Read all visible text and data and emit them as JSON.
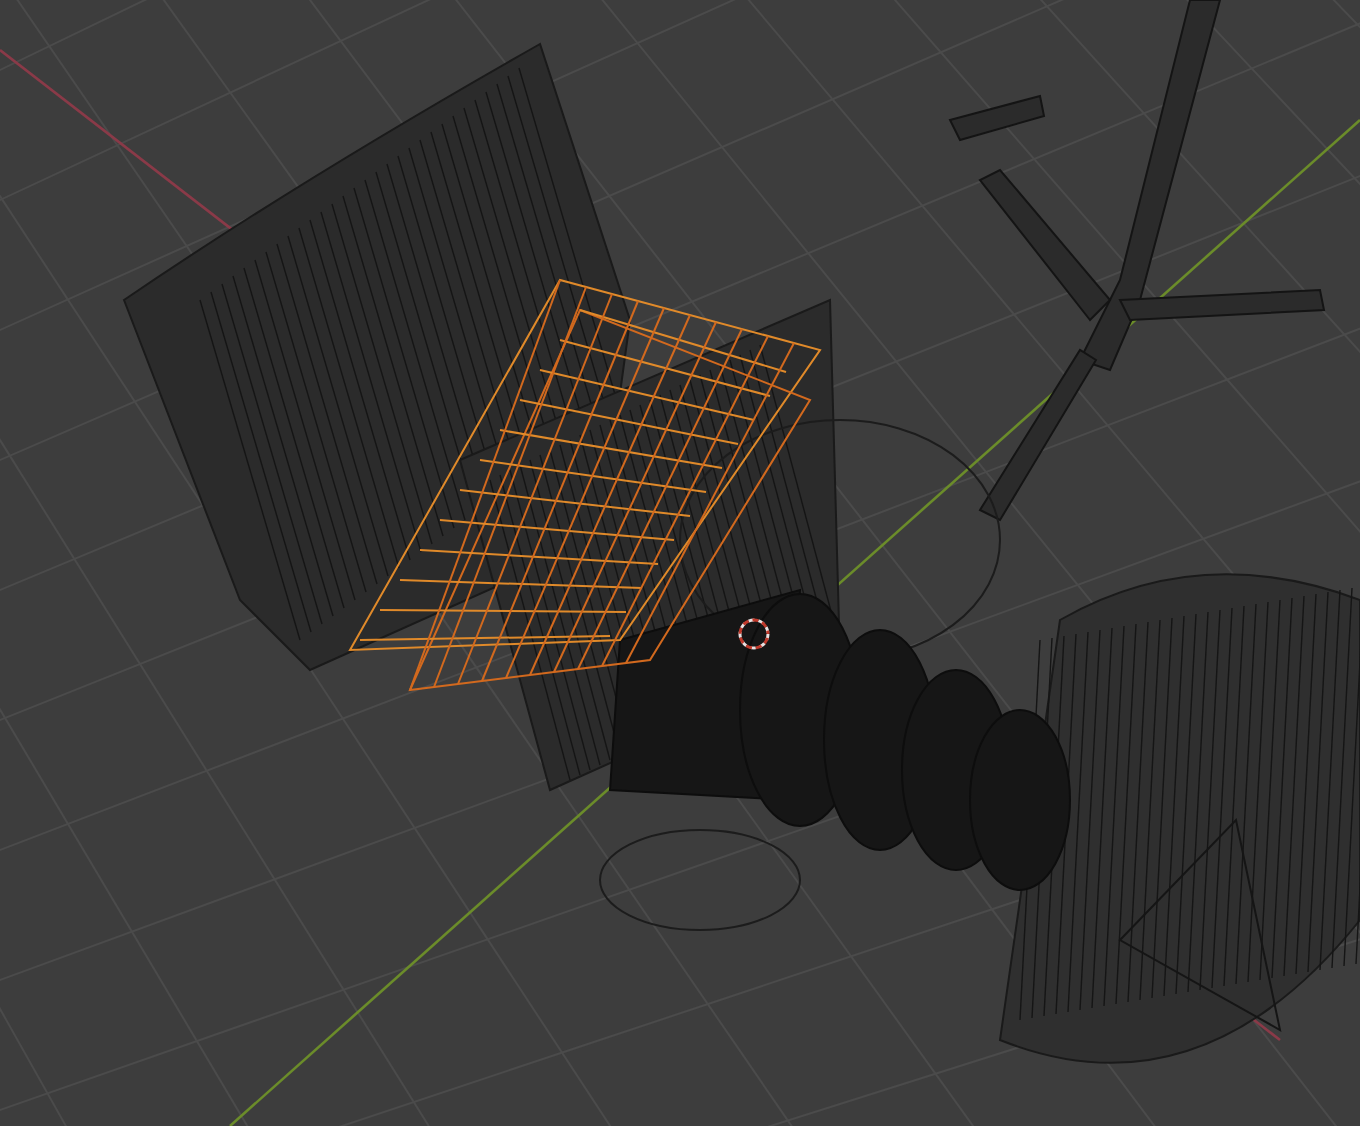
{
  "objects": [
    {
      "kind": "curved-panel",
      "selected": false
    },
    {
      "kind": "panel",
      "selected": false
    },
    {
      "kind": "frustum",
      "selected": true
    },
    {
      "kind": "tree",
      "selected": false
    },
    {
      "kind": "cylinder",
      "selected": false
    },
    {
      "kind": "lens",
      "selected": false
    }
  ]
}
